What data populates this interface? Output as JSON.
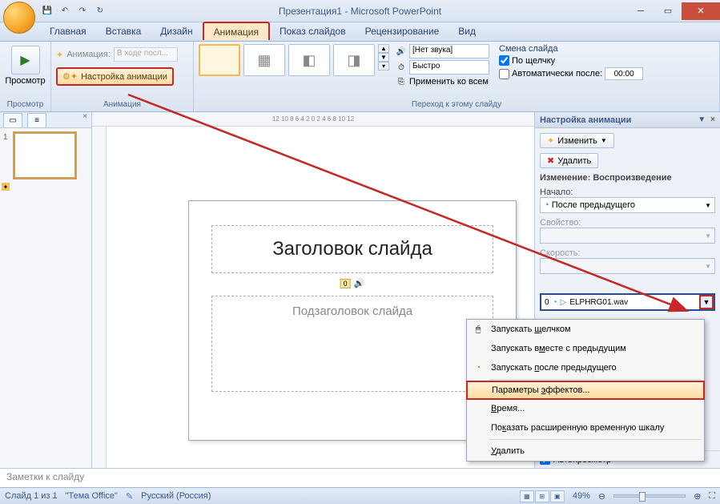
{
  "title": "Презентация1 - Microsoft PowerPoint",
  "qat": {
    "save": "💾",
    "undo": "↶",
    "redo": "↷",
    "refresh": "↻"
  },
  "tabs": [
    "Главная",
    "Вставка",
    "Дизайн",
    "Анимация",
    "Показ слайдов",
    "Рецензирование",
    "Вид"
  ],
  "active_tab": "Анимация",
  "ribbon": {
    "preview_group": "Просмотр",
    "preview_btn": "Просмотр",
    "anim_group": "Анимация",
    "anim_label": "Анимация:",
    "anim_value": "В ходе посл...",
    "custom_anim": "Настройка анимации",
    "trans_group": "Переход к этому слайду",
    "sound_label": "[Нет звука]",
    "speed_label": "Быстро",
    "apply_all": "Применить ко всем",
    "change_title": "Смена слайда",
    "on_click": "По щелчку",
    "auto_after": "Автоматически после:",
    "auto_time": "00:00"
  },
  "ruler": "12 10 8 6 4 2 0 2 4 6 8 10 12",
  "slide": {
    "title": "Заголовок слайда",
    "subtitle": "Подзаголовок слайда",
    "sound_num": "0"
  },
  "pane": {
    "title": "Настройка анимации",
    "modify": "Изменить",
    "delete": "Удалить",
    "change_label": "Изменение: Воспроизведение",
    "start_label": "Начало:",
    "start_value": "После предыдущего",
    "prop_label": "Свойство:",
    "speed_label": "Скорость:",
    "effect_num": "0",
    "effect_name": "ELPHRG01.wav",
    "autopreview": "Автопросмотр"
  },
  "ctx": {
    "on_click": "Запускать щелчком",
    "with_prev": "Запускать вместе с предыдущим",
    "after_prev": "Запускать после предыдущего",
    "effect_params": "Параметры эффектов...",
    "timing": "Время...",
    "show_timeline": "Показать расширенную временную шкалу",
    "remove": "Удалить"
  },
  "notes": "Заметки к слайду",
  "status": {
    "slide": "Слайд 1 из 1",
    "theme": "\"Тема Office\"",
    "lang": "Русский (Россия)",
    "zoom": "49%"
  }
}
